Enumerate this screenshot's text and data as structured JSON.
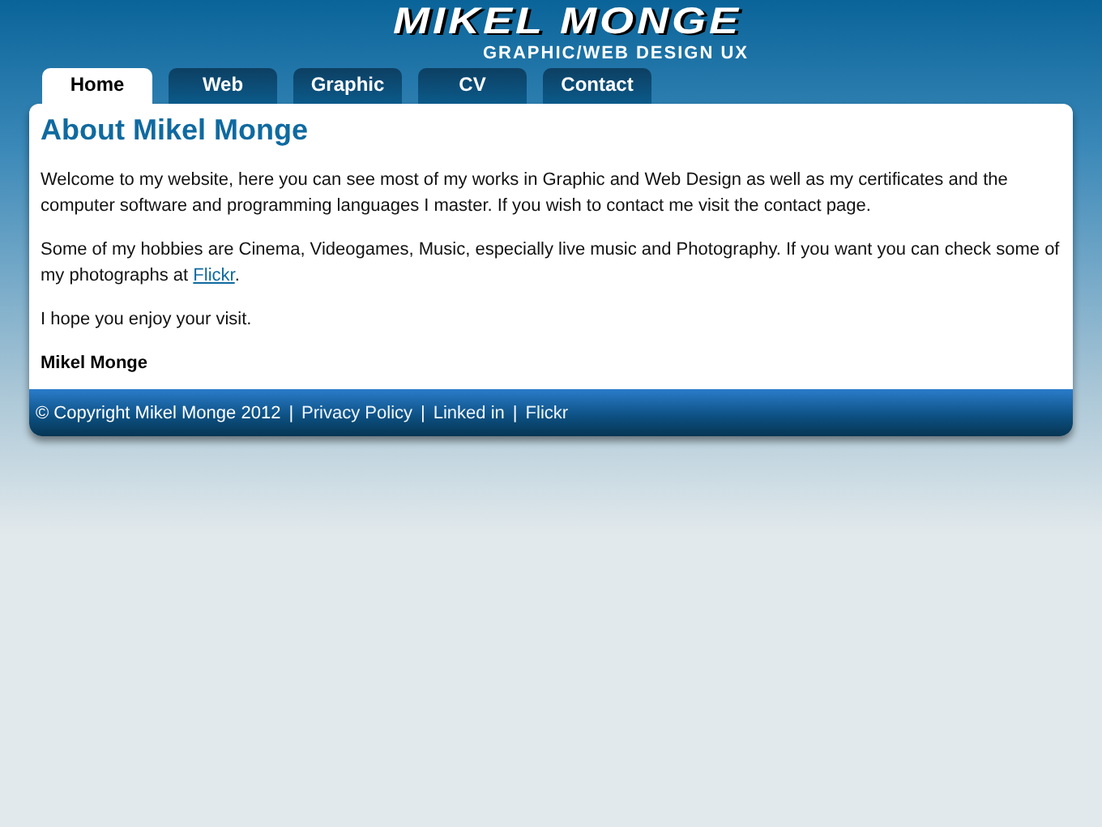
{
  "logo": {
    "title": "MIKEL MONGE",
    "subtitle": "GRAPHIC/WEB DESIGN UX"
  },
  "tabs": [
    {
      "label": "Home",
      "selected": true
    },
    {
      "label": "Web",
      "selected": false
    },
    {
      "label": "Graphic",
      "selected": false
    },
    {
      "label": "CV",
      "selected": false
    },
    {
      "label": "Contact",
      "selected": false
    }
  ],
  "content": {
    "heading": "About Mikel Monge",
    "paragraphs": [
      [
        {
          "kind": "text",
          "text": "Welcome to my website, here you can see most of my works in Graphic and Web Design as well as my certificates and the computer software and programming languages I master. If you wish to contact me visit the contact page."
        }
      ],
      [
        {
          "kind": "text",
          "text": "Some of my hobbies are Cinema, Videogames, Music, especially live music and Photography. If you want you can check some of my photographs at "
        },
        {
          "kind": "link",
          "text": "Flickr"
        },
        {
          "kind": "text",
          "text": "."
        }
      ],
      [
        {
          "kind": "text",
          "text": "I hope you enjoy your visit."
        }
      ]
    ],
    "signature": "Mikel Monge"
  },
  "footer": [
    {
      "kind": "text",
      "text": "© Copyright Mikel Monge 2012"
    },
    {
      "kind": "separator",
      "text": "|"
    },
    {
      "kind": "link",
      "text": "Privacy Policy"
    },
    {
      "kind": "separator",
      "text": "|"
    },
    {
      "kind": "link",
      "text": "Linked in"
    },
    {
      "kind": "separator",
      "text": "|"
    },
    {
      "kind": "link",
      "text": "Flickr"
    }
  ]
}
